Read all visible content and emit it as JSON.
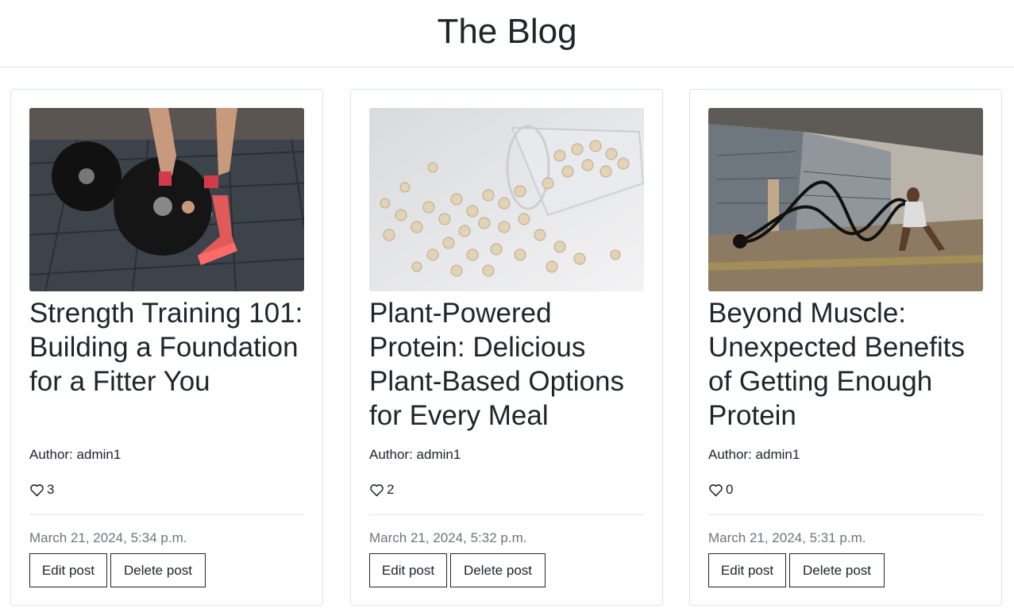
{
  "header": {
    "title": "The Blog"
  },
  "posts": [
    {
      "title": "Strength Training 101: Building a Foundation for a Fitter You",
      "author": "Author: admin1",
      "likes": "3",
      "date": "March 21, 2024, 5:34 p.m.",
      "edit_label": "Edit post",
      "delete_label": "Delete post",
      "image_icon": "barbell-photo"
    },
    {
      "title": "Plant-Powered Protein: Delicious Plant-Based Options for Every Meal",
      "author": "Author: admin1",
      "likes": "2",
      "date": "March 21, 2024, 5:32 p.m.",
      "edit_label": "Edit post",
      "delete_label": "Delete post",
      "image_icon": "chickpeas-photo"
    },
    {
      "title": "Beyond Muscle: Unexpected Benefits of Getting Enough Protein",
      "author": "Author: admin1",
      "likes": "0",
      "date": "March 21, 2024, 5:31 p.m.",
      "edit_label": "Edit post",
      "delete_label": "Delete post",
      "image_icon": "battle-ropes-photo"
    }
  ]
}
